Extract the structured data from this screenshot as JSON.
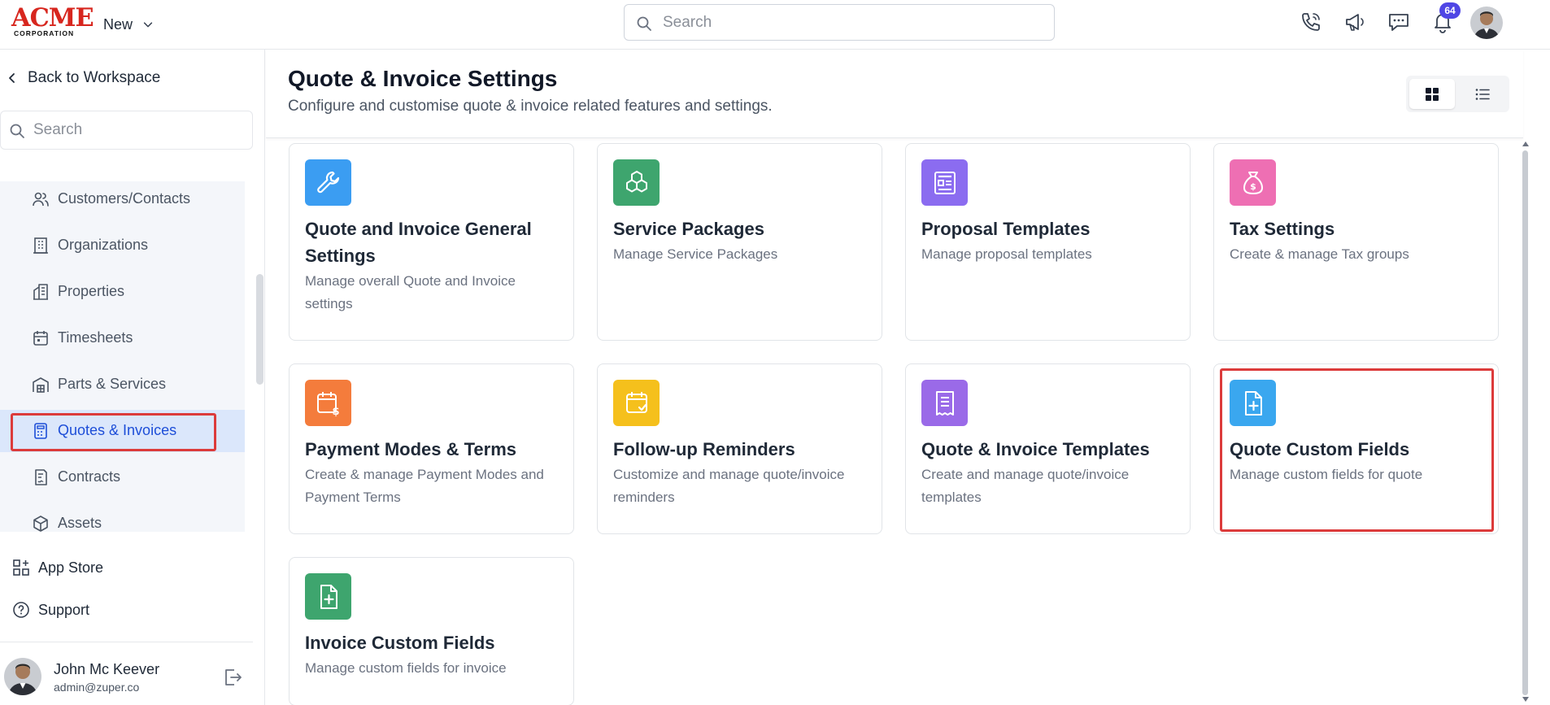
{
  "topbar": {
    "logo_word": "ACME",
    "logo_sub": "CORPORATION",
    "new_label": "New",
    "search_placeholder": "Search",
    "notification_count": "64"
  },
  "sidebar": {
    "back_label": "Back to Workspace",
    "search_placeholder": "Search",
    "items": [
      {
        "label": "Customers/Contacts",
        "icon": "users-icon"
      },
      {
        "label": "Organizations",
        "icon": "building-icon"
      },
      {
        "label": "Properties",
        "icon": "properties-icon"
      },
      {
        "label": "Timesheets",
        "icon": "calendar-icon"
      },
      {
        "label": "Parts & Services",
        "icon": "warehouse-icon"
      },
      {
        "label": "Quotes & Invoices",
        "icon": "calculator-icon",
        "active": true
      },
      {
        "label": "Contracts",
        "icon": "contract-icon"
      },
      {
        "label": "Assets",
        "icon": "cube-icon"
      }
    ],
    "app_store_label": "App Store",
    "support_label": "Support",
    "user": {
      "name": "John Mc Keever",
      "email": "admin@zuper.co"
    }
  },
  "main": {
    "title": "Quote & Invoice Settings",
    "subtitle": "Configure and customise quote & invoice related features and settings.",
    "cards": [
      {
        "title": "Quote and Invoice General Settings",
        "desc": "Manage overall Quote and Invoice settings",
        "icon": "wrench-icon",
        "color": "#3b9df2"
      },
      {
        "title": "Service Packages",
        "desc": "Manage Service Packages",
        "icon": "boxes-icon",
        "color": "#3ea56e"
      },
      {
        "title": "Proposal Templates",
        "desc": "Manage proposal templates",
        "icon": "template-icon",
        "color": "#8b6cf0"
      },
      {
        "title": "Tax Settings",
        "desc": "Create & manage Tax groups",
        "icon": "money-bag-icon",
        "color": "#ee6fb3"
      },
      {
        "title": "Payment Modes & Terms",
        "desc": "Create & manage Payment Modes and Payment Terms",
        "icon": "calendar-dollar-icon",
        "color": "#f47c3c"
      },
      {
        "title": "Follow-up Reminders",
        "desc": "Customize and manage quote/invoice reminders",
        "icon": "calendar-check-icon",
        "color": "#f5c01c"
      },
      {
        "title": "Quote & Invoice Templates",
        "desc": "Create and manage quote/invoice templates",
        "icon": "receipt-icon",
        "color": "#9a6ae8"
      },
      {
        "title": "Quote Custom Fields",
        "desc": "Manage custom fields for quote",
        "icon": "file-plus-icon",
        "color": "#3aa7ef"
      },
      {
        "title": "Invoice Custom Fields",
        "desc": "Manage custom fields for invoice",
        "icon": "file-plus-icon",
        "color": "#3ea56e"
      }
    ]
  }
}
